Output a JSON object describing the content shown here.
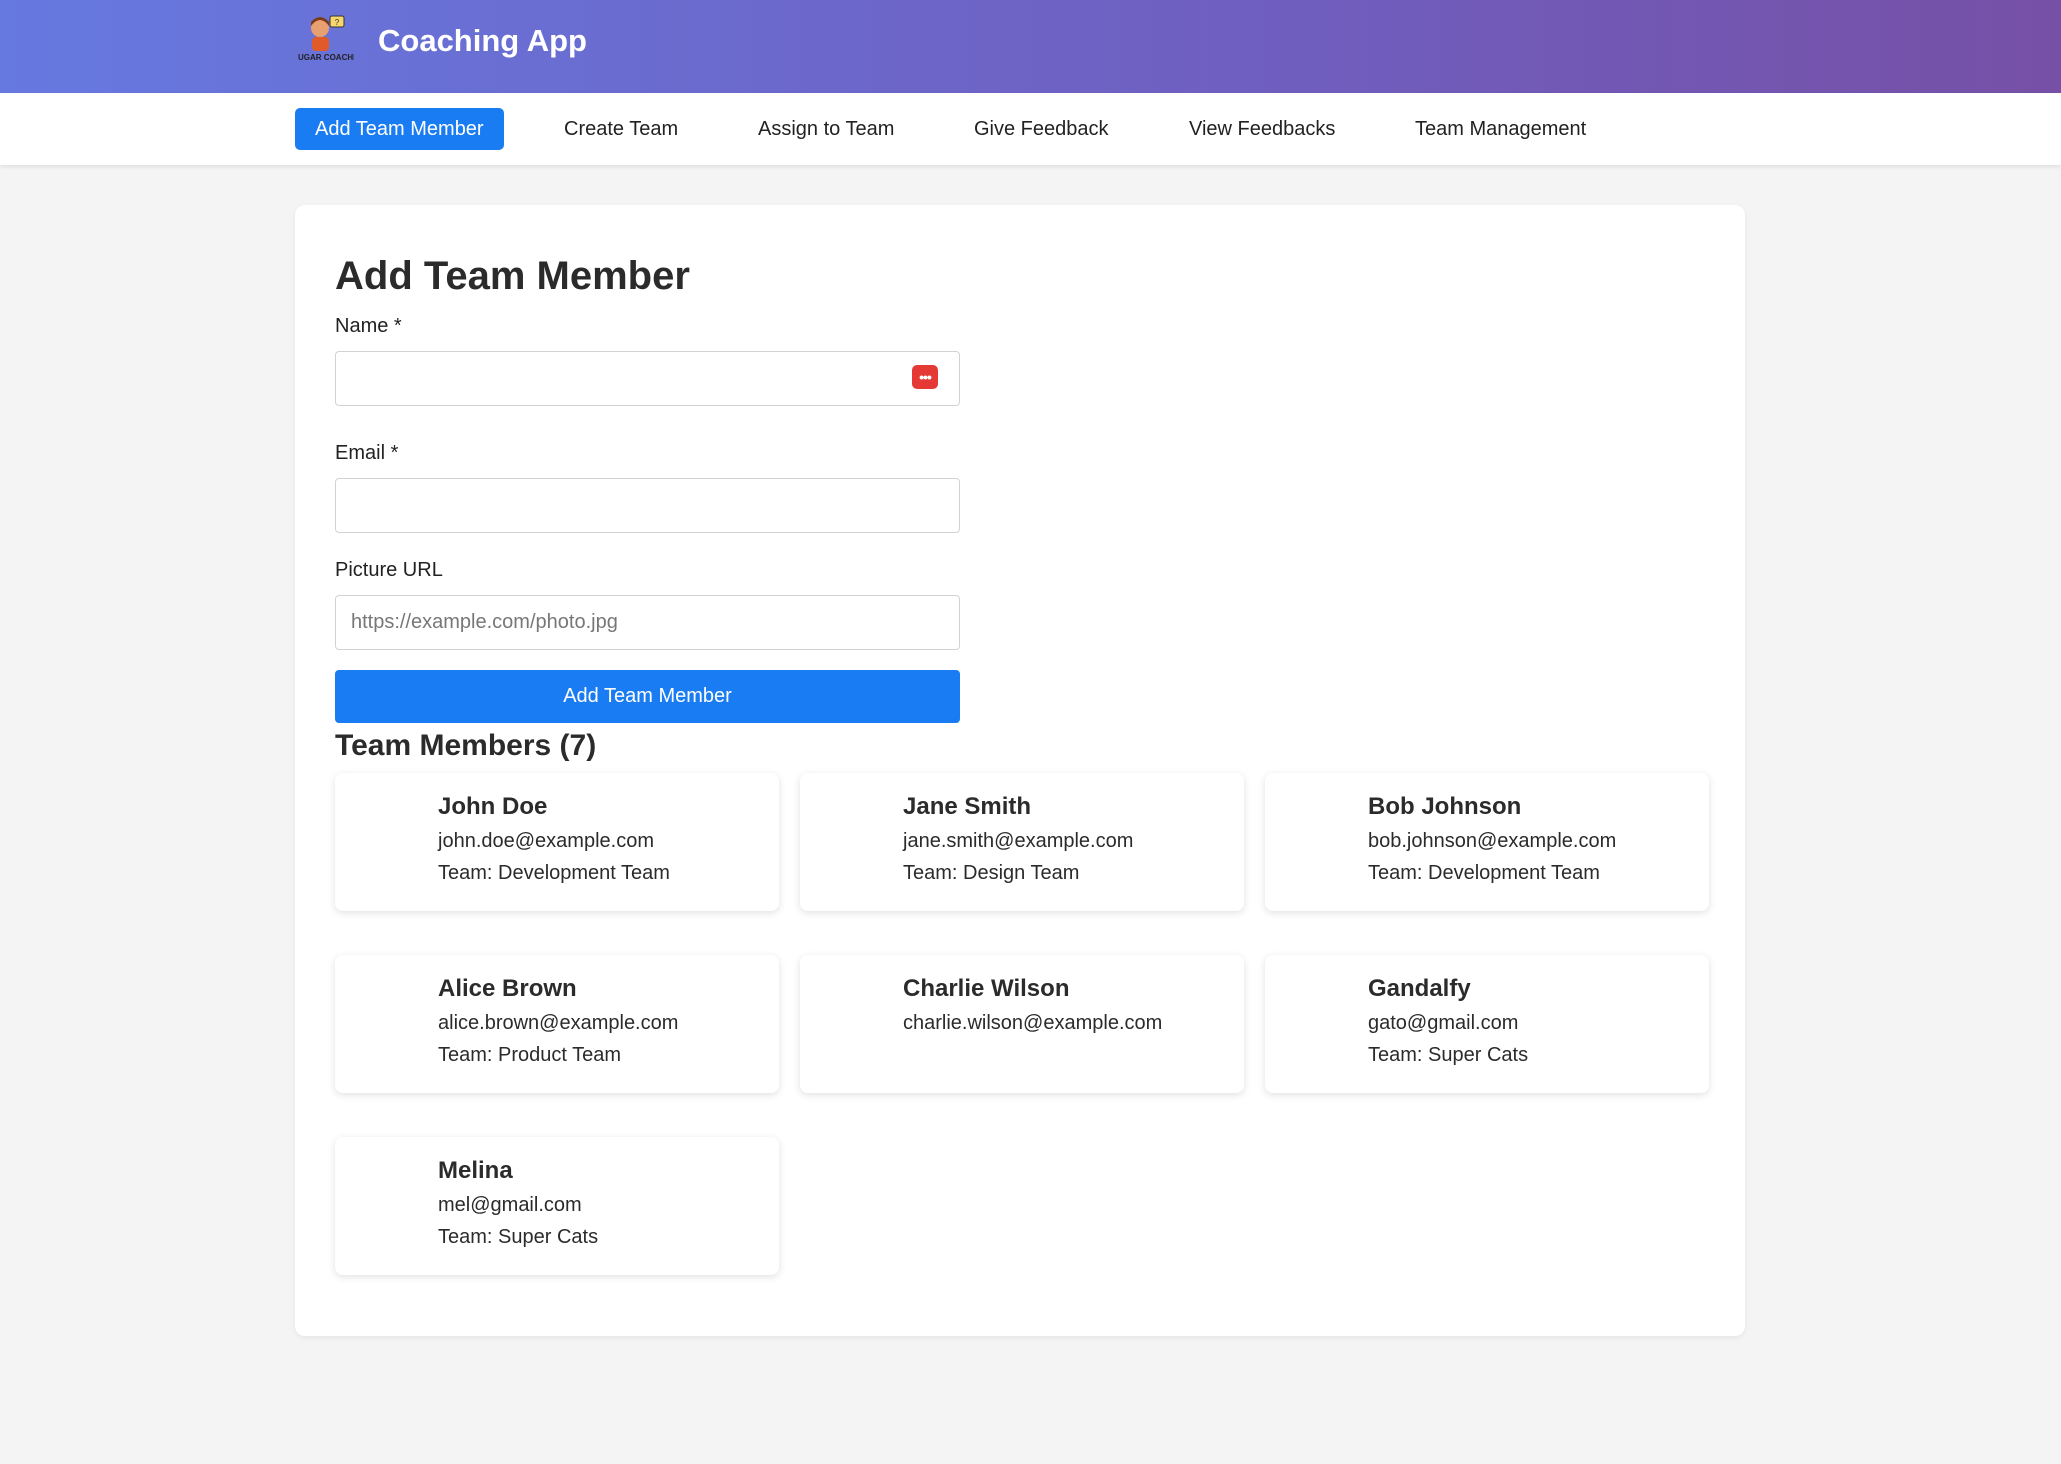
{
  "app": {
    "title": "Coaching App",
    "logo_icon": "coaching-mascot-logo-icon",
    "logo_text": "NOSUGAR COACHING"
  },
  "nav": {
    "items": [
      {
        "label": "Add Team Member",
        "active": true
      },
      {
        "label": "Create Team",
        "active": false
      },
      {
        "label": "Assign to Team",
        "active": false
      },
      {
        "label": "Give Feedback",
        "active": false
      },
      {
        "label": "View Feedbacks",
        "active": false
      },
      {
        "label": "Team Management",
        "active": false
      }
    ]
  },
  "form": {
    "title": "Add Team Member",
    "name_label": "Name *",
    "name_value": "",
    "email_label": "Email *",
    "email_value": "",
    "picture_label": "Picture URL",
    "picture_placeholder": "https://example.com/photo.jpg",
    "password_manager_icon": "password-manager-icon",
    "submit_label": "Add Team Member"
  },
  "members": {
    "title": "Team Members (7)",
    "list": [
      {
        "name": "John Doe",
        "email": "john.doe@example.com",
        "team": "Team: Development Team"
      },
      {
        "name": "Jane Smith",
        "email": "jane.smith@example.com",
        "team": "Team: Design Team"
      },
      {
        "name": "Bob Johnson",
        "email": "bob.johnson@example.com",
        "team": "Team: Development Team"
      },
      {
        "name": "Alice Brown",
        "email": "alice.brown@example.com",
        "team": "Team: Product Team"
      },
      {
        "name": "Charlie Wilson",
        "email": "charlie.wilson@example.com",
        "team": ""
      },
      {
        "name": "Gandalfy",
        "email": "gato@gmail.com",
        "team": "Team: Super Cats"
      },
      {
        "name": "Melina",
        "email": "mel@gmail.com",
        "team": "Team: Super Cats"
      }
    ]
  },
  "colors": {
    "accent": "#1a7cf2",
    "header_gradient_start": "#6679e0",
    "header_gradient_end": "#7650a6",
    "page_background": "#f4f4f4"
  }
}
